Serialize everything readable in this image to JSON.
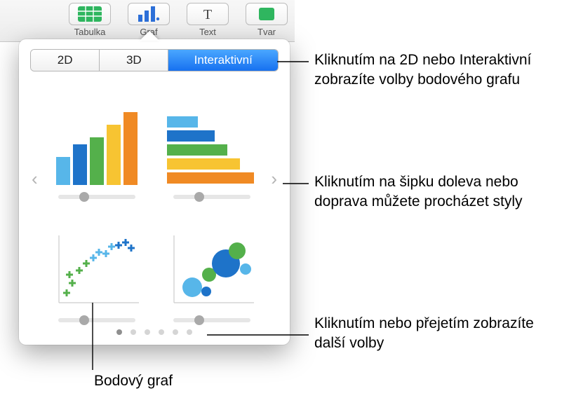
{
  "toolbar": {
    "items": [
      {
        "label": "Tabulka",
        "color": "#2fb65f",
        "icon": "table"
      },
      {
        "label": "Graf",
        "color": "#2c6fd8",
        "icon": "bars"
      },
      {
        "label": "Text",
        "color": "#444444",
        "icon": "text"
      },
      {
        "label": "Tvar",
        "color": "#2fb65f",
        "icon": "shape"
      }
    ]
  },
  "segments": {
    "a": "2D",
    "b": "3D",
    "c": "Interaktivní",
    "selected": "c"
  },
  "charts": [
    {
      "kind": "bar-vertical"
    },
    {
      "kind": "bar-horizontal"
    },
    {
      "kind": "scatter-plus"
    },
    {
      "kind": "bubble"
    }
  ],
  "page_dots": 6,
  "current_dot": 0,
  "callouts": {
    "tabs": "Kliknutím na 2D nebo Interaktivní zobrazíte volby bodového grafu",
    "arrow": "Kliknutím na šipku doleva nebo doprava můžete procházet styly",
    "dots": "Kliknutím nebo přejetím zobrazíte další volby",
    "scatter_label": "Bodový graf"
  }
}
